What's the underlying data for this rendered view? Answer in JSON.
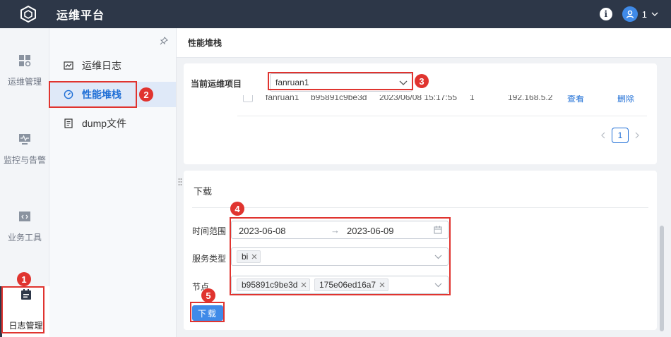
{
  "app": {
    "title": "运维平台"
  },
  "user": {
    "name": "1"
  },
  "sidebar": {
    "items": [
      {
        "label": "运维管理",
        "icon": "grid-icon"
      },
      {
        "label": "监控与告警",
        "icon": "monitor-icon"
      },
      {
        "label": "业务工具",
        "icon": "code-icon"
      },
      {
        "label": "日志管理",
        "icon": "log-icon",
        "active": true
      }
    ]
  },
  "submenu": {
    "items": [
      {
        "label": "运维日志",
        "icon": "chart-icon"
      },
      {
        "label": "性能堆栈",
        "icon": "gauge-icon",
        "active": true
      },
      {
        "label": "dump文件",
        "icon": "file-icon"
      }
    ]
  },
  "breadcrumb": "性能堆栈",
  "project": {
    "label": "当前运维项目",
    "value": "fanruan1"
  },
  "table_row": {
    "name": "fanruan1",
    "node": "b95891c9be3d",
    "time": "2023/06/08 15:17:55",
    "count": "1",
    "ip": "192.168.5.2",
    "view": "查看",
    "delete": "删除"
  },
  "pagination": {
    "current": "1"
  },
  "download": {
    "title": "下载",
    "time_label": "时间范围",
    "start_date": "2023-06-08",
    "range_arrow": "→",
    "end_date": "2023-06-09",
    "service_label": "服务类型",
    "service_tags": [
      "bi"
    ],
    "node_label": "节点",
    "node_tags": [
      "b95891c9be3d",
      "175e06ed16a7"
    ],
    "button": "下载"
  },
  "annotations": [
    "1",
    "2",
    "3",
    "4",
    "5"
  ],
  "colors": {
    "topbar": "#2d3748",
    "accent": "#1f6fd6",
    "highlight": "#e0342f",
    "button": "#3f8ae8"
  }
}
